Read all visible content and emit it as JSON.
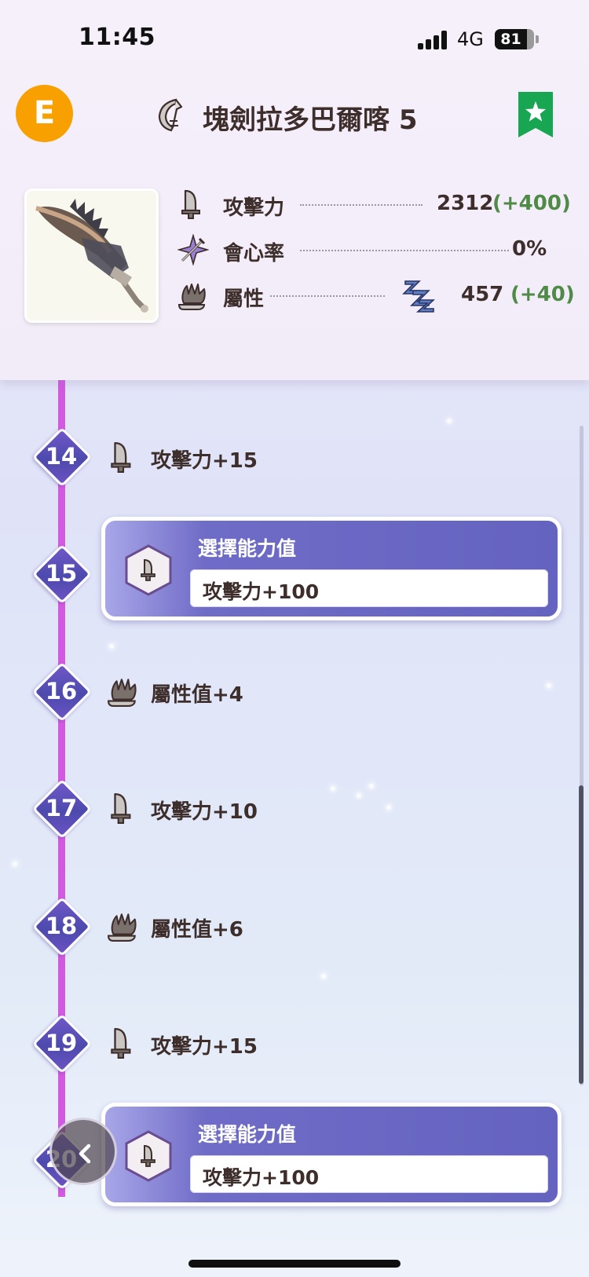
{
  "status_bar": {
    "time": "11:45",
    "network": "4G",
    "battery": "81",
    "battery_level": 0.81
  },
  "header": {
    "rank_badge": "E",
    "weapon_name": "塊劍拉多巴爾喀 5",
    "weapon_type_icon": "greatsword-icon",
    "bookmark_icon": "star-bookmark-icon",
    "bookmark_color": "#19a653"
  },
  "stats": {
    "attack": {
      "label": "攻擊力",
      "value": "2312",
      "bonus": "(+400)"
    },
    "affinity": {
      "label": "會心率",
      "value": "0%"
    },
    "element": {
      "label": "屬性",
      "element_icon": "sleep-element-icon",
      "value": "457",
      "bonus": "(+40)"
    }
  },
  "timeline": {
    "line_color": "#d25ae0",
    "nodes": [
      {
        "level": "14",
        "type": "bonus",
        "icon": "attack-icon",
        "text": "攻擊力+15"
      },
      {
        "level": "15",
        "type": "select",
        "title": "選擇能力值",
        "value": "攻擊力+100"
      },
      {
        "level": "16",
        "type": "bonus",
        "icon": "element-icon",
        "text": "屬性值+4"
      },
      {
        "level": "17",
        "type": "bonus",
        "icon": "attack-icon",
        "text": "攻擊力+10"
      },
      {
        "level": "18",
        "type": "bonus",
        "icon": "element-icon",
        "text": "屬性值+6"
      },
      {
        "level": "19",
        "type": "bonus",
        "icon": "attack-icon",
        "text": "攻擊力+15"
      },
      {
        "level": "20",
        "type": "select",
        "title": "選擇能力值",
        "value": "攻擊力+100"
      }
    ]
  },
  "back_button_icon": "chevron-left-icon"
}
